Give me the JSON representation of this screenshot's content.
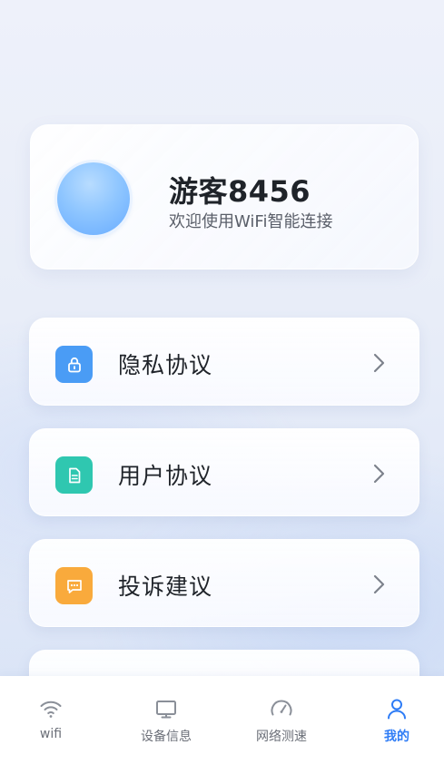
{
  "profile": {
    "username": "游客8456",
    "welcome": "欢迎使用WiFi智能连接"
  },
  "menu": [
    {
      "label": "隐私协议",
      "icon": "lock-icon",
      "color": "#4a9cf5"
    },
    {
      "label": "用户协议",
      "icon": "document-icon",
      "color": "#2fc7b0"
    },
    {
      "label": "投诉建议",
      "icon": "message-icon",
      "color": "#f9aa3c"
    }
  ],
  "tabbar": {
    "items": [
      {
        "label": "wifi",
        "icon": "wifi-icon"
      },
      {
        "label": "设备信息",
        "icon": "monitor-icon"
      },
      {
        "label": "网络测速",
        "icon": "speedometer-icon"
      },
      {
        "label": "我的",
        "icon": "user-icon",
        "active": true
      }
    ]
  },
  "colors": {
    "accent": "#2e7cf6",
    "text_primary": "#1f2329",
    "text_secondary": "#5a5f69",
    "tab_inactive": "#6b6f78"
  }
}
